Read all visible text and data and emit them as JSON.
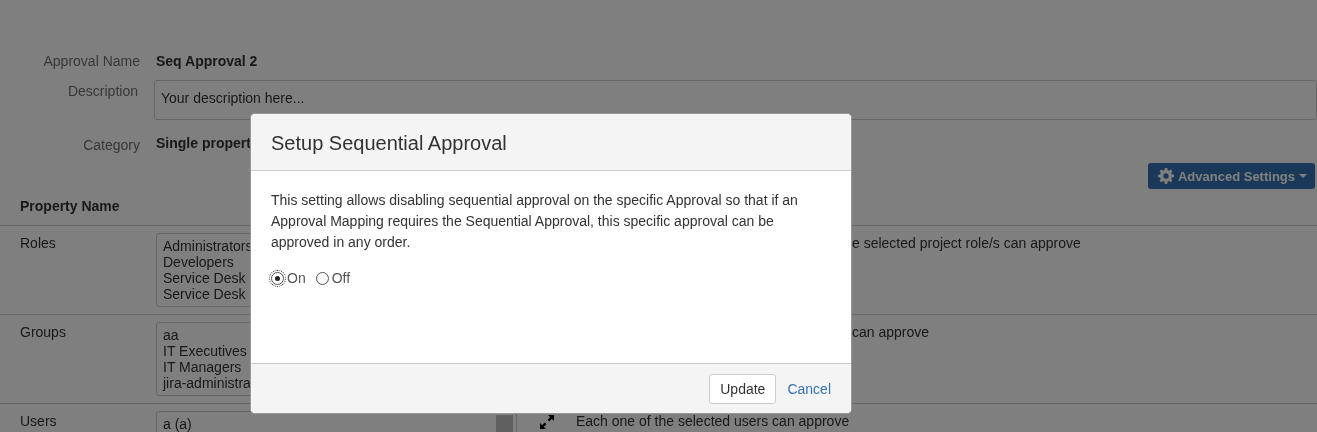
{
  "form": {
    "fields": [
      {
        "label": "Approval Name",
        "kind": "text",
        "value": "Seq Approval 2"
      },
      {
        "label": "Description",
        "kind": "textarea",
        "value": "Your description here..."
      },
      {
        "label": "Category",
        "kind": "text",
        "value": "Single propert"
      }
    ]
  },
  "advanced_settings_button": {
    "label": "Advanced Settings"
  },
  "table": {
    "column_1": "Property Name",
    "rows": [
      {
        "label": "Roles",
        "options": [
          "Administrators",
          "Developers",
          "Service Desk",
          "Service Desk"
        ],
        "covered": true,
        "note": "e selected project role/s can approve"
      },
      {
        "label": "Groups",
        "options": [
          "aa",
          "IT Executives",
          "IT Managers",
          "jira-administra"
        ],
        "covered": true,
        "note": "can approve"
      },
      {
        "label": "Users",
        "options": [
          "a (a)"
        ],
        "covered": false,
        "note": "Each one of the selected users can approve"
      }
    ]
  },
  "modal": {
    "title": "Setup Sequential Approval",
    "message": "This setting allows disabling sequential approval on the specific Approval so that if an Approval Mapping requires the Sequential Approval, this specific approval can be approved in any order.",
    "options": [
      {
        "label": "On",
        "selected": true
      },
      {
        "label": "Off",
        "selected": false
      }
    ],
    "buttons": [
      {
        "label": "Update",
        "kind": "button"
      },
      {
        "label": "Cancel",
        "kind": "link"
      }
    ]
  }
}
